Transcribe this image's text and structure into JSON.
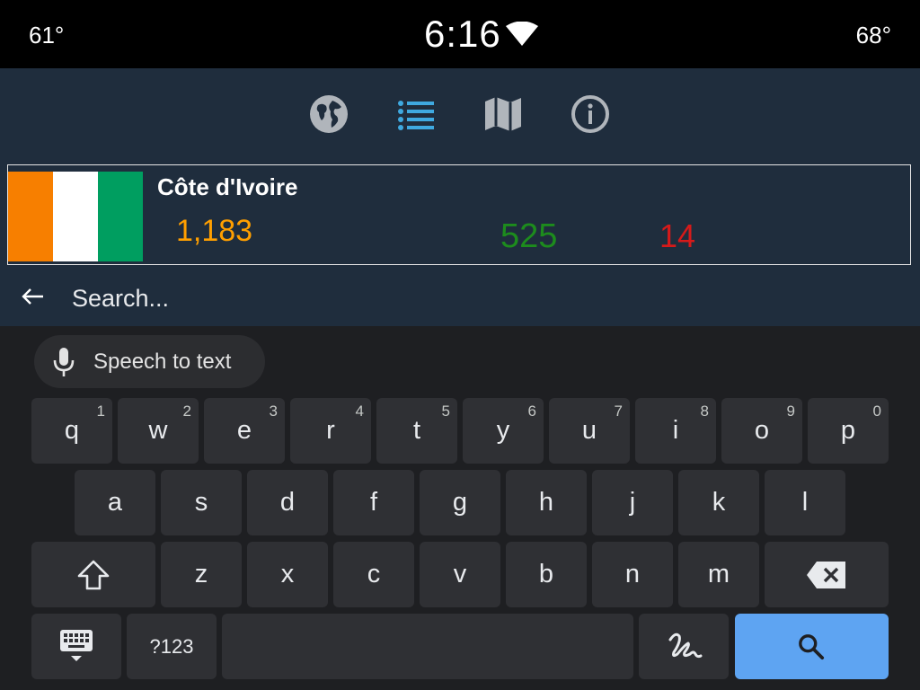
{
  "status_bar": {
    "temp_left": "61°",
    "clock": "6:16",
    "temp_right": "68°"
  },
  "nav": {
    "icons": [
      "globe-icon",
      "list-icon",
      "map-icon",
      "info-icon"
    ],
    "active_color": "#3fa9e0",
    "inactive_color": "#b0b5bb"
  },
  "country": {
    "name": "Côte d'Ivoire",
    "cases": "1,183",
    "recovered": "525",
    "deaths": "14",
    "flag_colors": [
      "#f77f00",
      "#ffffff",
      "#009e60"
    ]
  },
  "search": {
    "placeholder": "Search..."
  },
  "keyboard": {
    "speech_to_text_label": "Speech to text",
    "row1": [
      {
        "key": "q",
        "hint": "1"
      },
      {
        "key": "w",
        "hint": "2"
      },
      {
        "key": "e",
        "hint": "3"
      },
      {
        "key": "r",
        "hint": "4"
      },
      {
        "key": "t",
        "hint": "5"
      },
      {
        "key": "y",
        "hint": "6"
      },
      {
        "key": "u",
        "hint": "7"
      },
      {
        "key": "i",
        "hint": "8"
      },
      {
        "key": "o",
        "hint": "9"
      },
      {
        "key": "p",
        "hint": "0"
      }
    ],
    "row2": [
      "a",
      "s",
      "d",
      "f",
      "g",
      "h",
      "j",
      "k",
      "l"
    ],
    "row3": [
      "z",
      "x",
      "c",
      "v",
      "b",
      "n",
      "m"
    ],
    "symbols_label": "?123",
    "action_color": "#5ea4f2"
  }
}
